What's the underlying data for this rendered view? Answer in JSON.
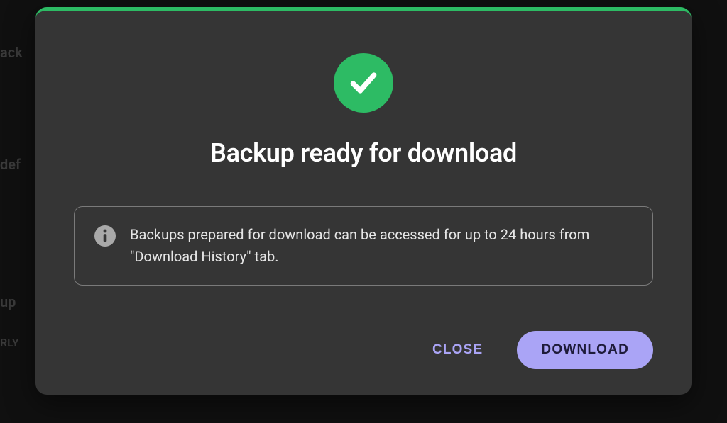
{
  "background": {
    "fragments": [
      "ack",
      "def",
      "up",
      "RLY"
    ]
  },
  "modal": {
    "title": "Backup ready for download",
    "info_text": "Backups prepared for download can be accessed for up to 24 hours from \"Download History\" tab.",
    "close_label": "CLOSE",
    "download_label": "DOWNLOAD",
    "accent_color": "#2dbb64",
    "button_color": "#aaa4f6"
  }
}
